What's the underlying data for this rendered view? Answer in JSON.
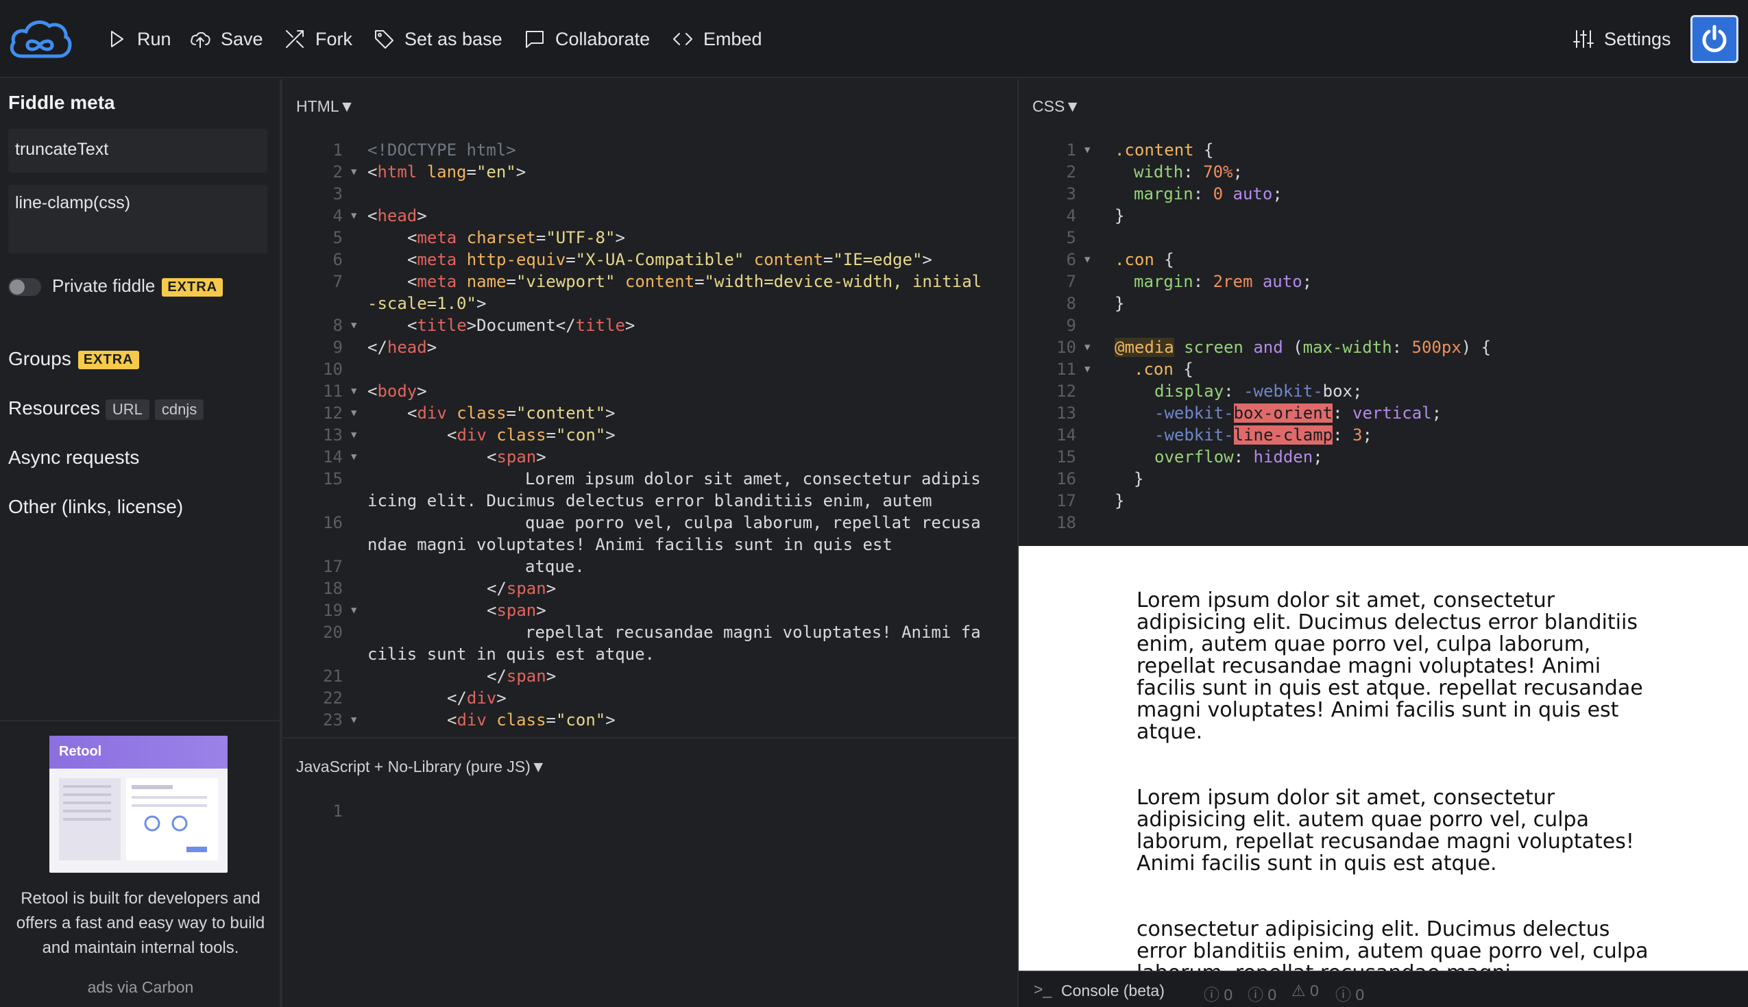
{
  "toolbar": {
    "run": "Run",
    "save": "Save",
    "fork": "Fork",
    "set_as_base": "Set as base",
    "collaborate": "Collaborate",
    "embed": "Embed",
    "settings": "Settings"
  },
  "sidebar": {
    "title": "Fiddle meta",
    "fiddle_title_value": "truncateText",
    "fiddle_desc_value": "line-clamp(css)",
    "private_label": "Private fiddle",
    "extra_badge": "EXTRA",
    "groups": "Groups",
    "resources": "Resources",
    "url_badge": "URL",
    "cdnjs_badge": "cdnjs",
    "async": "Async requests",
    "other": "Other (links, license)",
    "ad_brand": "Retool",
    "ad_text": "Retool is built for developers and offers a fast and easy way to build and maintain internal tools.",
    "ad_via": "ads via Carbon"
  },
  "panels": {
    "html_title": "HTML▼",
    "css_title": "CSS▼",
    "js_title": "JavaScript + No-Library (pure JS)▼",
    "console_title": "Console (beta)",
    "console_counts": [
      "0",
      "0",
      "0",
      "0"
    ]
  },
  "result": {
    "p1": "Lorem ipsum dolor sit amet, consectetur adipisicing elit. Ducimus delectus error blanditiis enim, autem quae porro vel, culpa laborum, repellat recusandae magni voluptates! Animi facilis sunt in quis est atque. repellat recusandae magni voluptates! Animi facilis sunt in quis est atque.",
    "p2": "Lorem ipsum dolor sit amet, consectetur adipisicing elit. autem quae porro vel, culpa laborum, repellat recusandae magni voluptates! Animi facilis sunt in quis est atque.",
    "p3": "consectetur adipisicing elit. Ducimus delectus error blanditiis enim, autem quae porro vel, culpa laborum, repellat recusandae magni"
  },
  "colors": {
    "accent": "#2f6fd8",
    "extra_badge": "#f5c94a",
    "highlight": "#e06a6a"
  }
}
